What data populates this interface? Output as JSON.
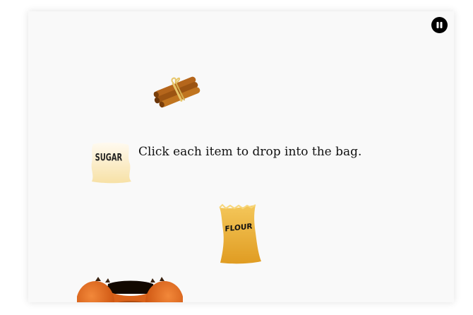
{
  "instructions": "Click each item to drop into the bag.",
  "items": [
    {
      "name": "cinnamon",
      "icon": "cinnamon-sticks-icon"
    },
    {
      "name": "sugar",
      "label": "SUGAR",
      "icon": "sugar-sack-icon"
    },
    {
      "name": "flour",
      "label": "FLOUR",
      "icon": "flour-sack-icon"
    }
  ],
  "controls": {
    "pause_icon": "pause-icon"
  },
  "colors": {
    "background": "#f9f9f9",
    "bag": "#e06a14",
    "flour": "#e8a92d",
    "sugar": "#fbefc9",
    "cinnamon": "#b5661c"
  }
}
